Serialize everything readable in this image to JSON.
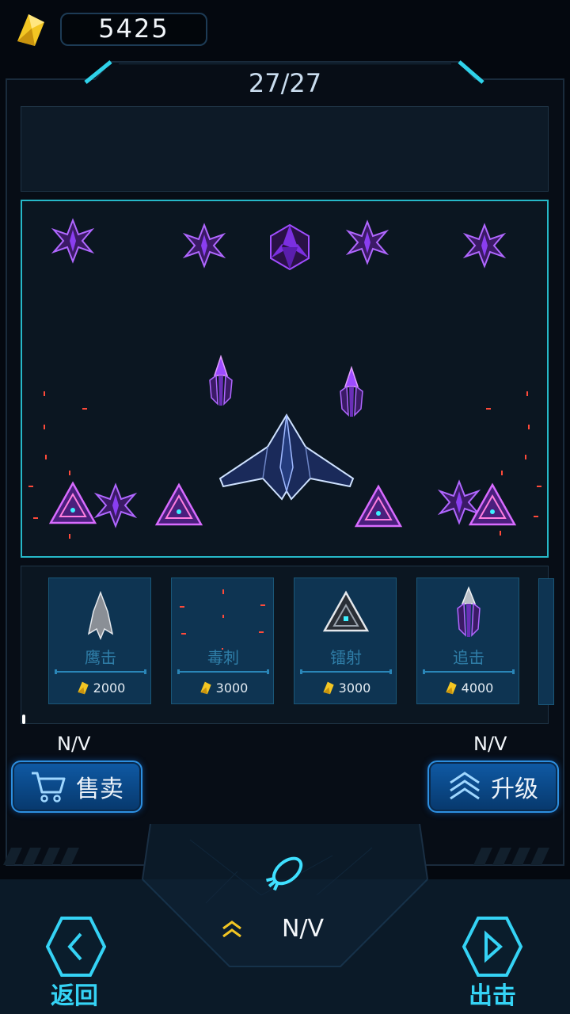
{
  "currency": {
    "amount": "5425",
    "icon": "gold-crystal-icon"
  },
  "hangar": {
    "counter": "27/27"
  },
  "shop": {
    "items": [
      {
        "name": "鹰击",
        "price": "2000"
      },
      {
        "name": "毒刺",
        "price": "3000"
      },
      {
        "name": "镭射",
        "price": "3000"
      },
      {
        "name": "追击",
        "price": "4000"
      }
    ]
  },
  "actions": {
    "sell_value": "N/V",
    "sell_label": "售卖",
    "upgrade_value": "N/V",
    "upgrade_label": "升级"
  },
  "bottom": {
    "level_value": "N/V",
    "back_label": "返回",
    "deploy_label": "出击"
  },
  "colors": {
    "accent": "#26b8c8",
    "button": "#0f5aa5",
    "nav_label": "#35d3f5",
    "gold": "#f3c623"
  }
}
